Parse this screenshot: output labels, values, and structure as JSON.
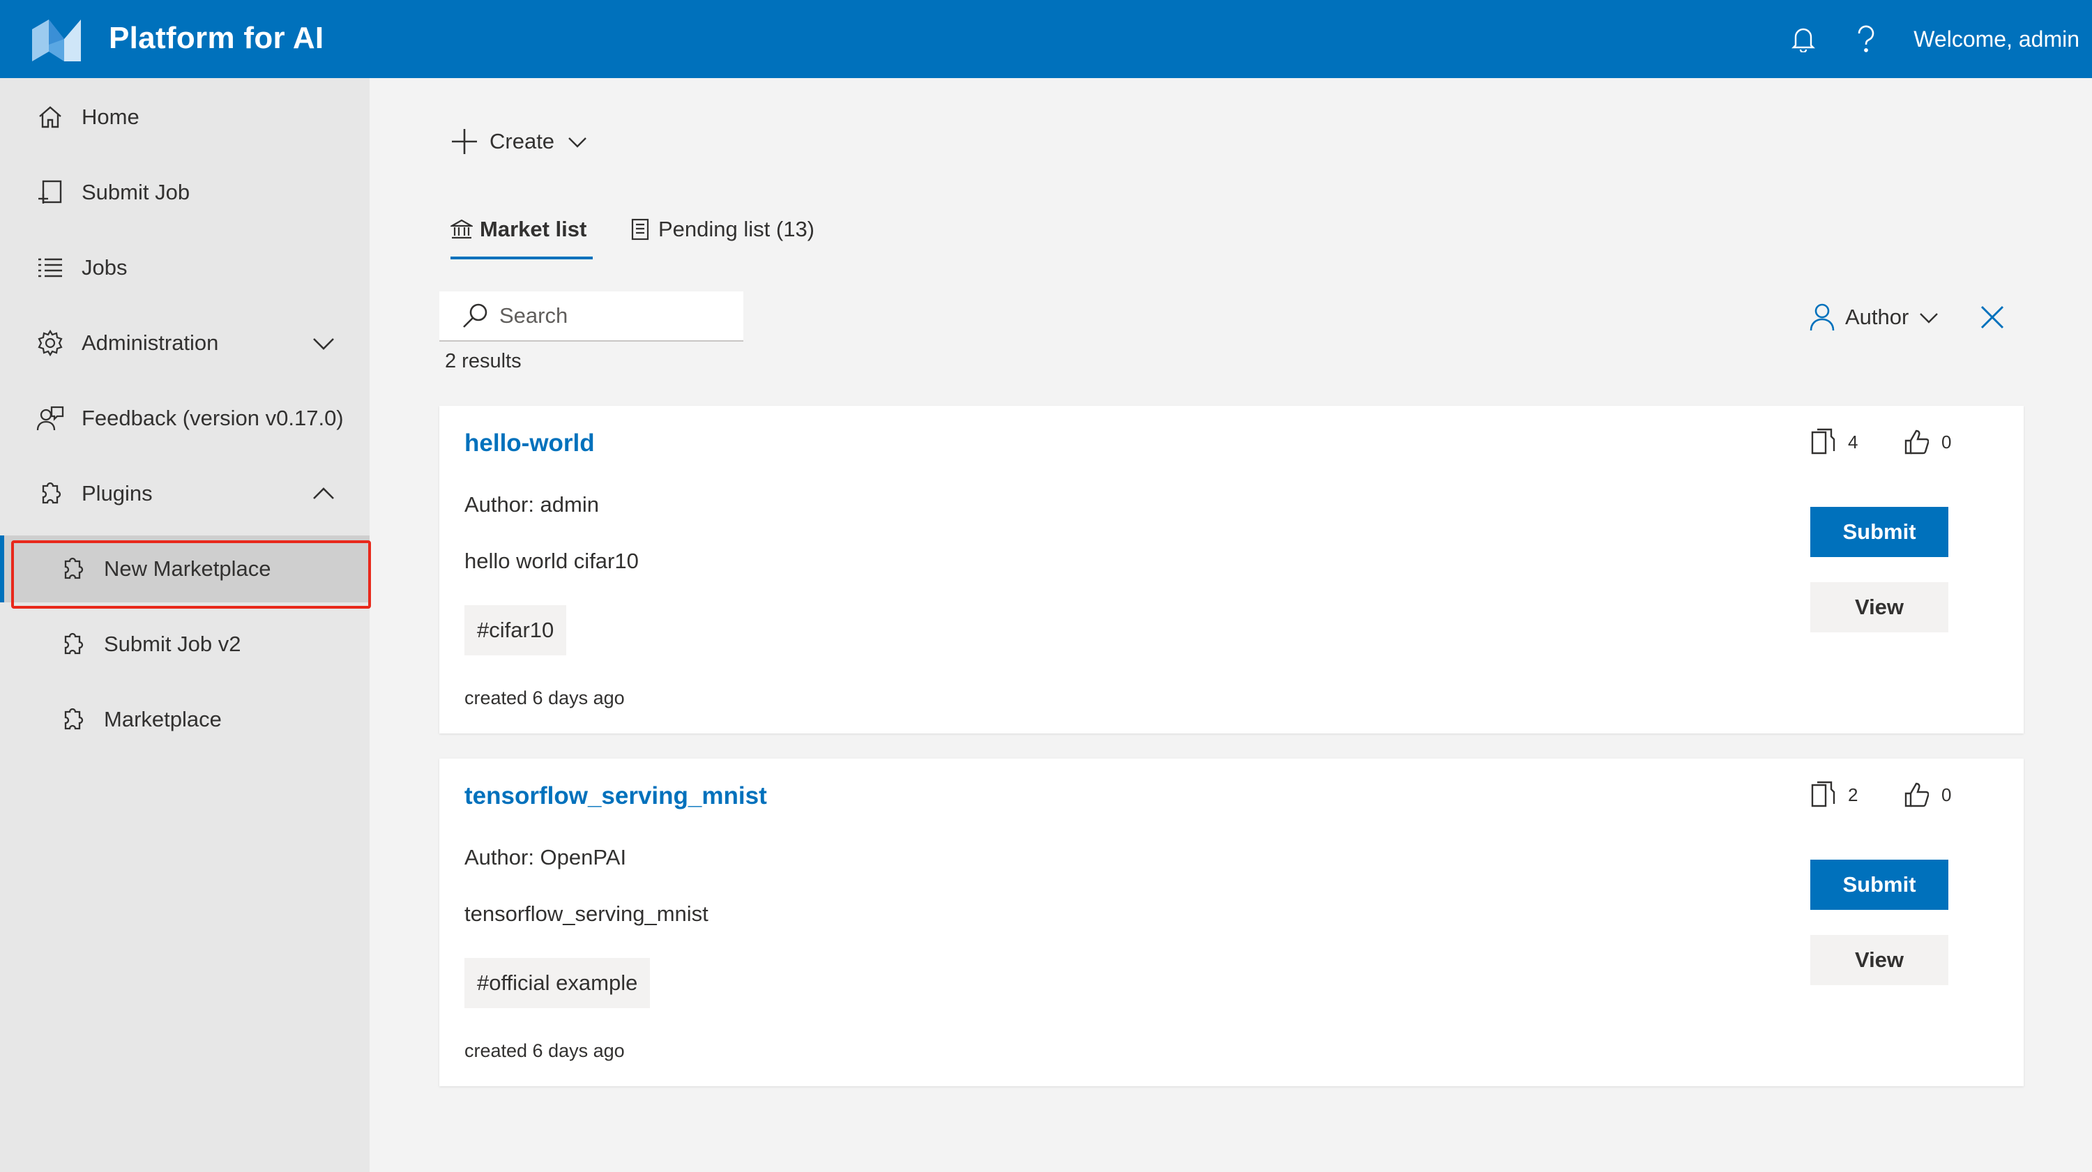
{
  "header": {
    "app_title": "Platform for AI",
    "welcome": "Welcome, admin",
    "icons": [
      "app-logo",
      "bell-icon",
      "help-icon"
    ],
    "brand_color": "#0071bc"
  },
  "sidebar": {
    "items": [
      {
        "label": "Home",
        "icon": "home-icon"
      },
      {
        "label": "Submit Job",
        "icon": "submit-job-icon"
      },
      {
        "label": "Jobs",
        "icon": "list-icon"
      },
      {
        "label": "Administration",
        "icon": "gear-icon",
        "expandable": true,
        "expanded": false
      },
      {
        "label": "Feedback (version v0.17.0)",
        "icon": "feedback-icon"
      },
      {
        "label": "Plugins",
        "icon": "puzzle-icon",
        "expandable": true,
        "expanded": true
      }
    ],
    "plugin_items": [
      {
        "label": "New Marketplace",
        "icon": "puzzle-icon",
        "selected": true
      },
      {
        "label": "Submit Job v2",
        "icon": "puzzle-icon"
      },
      {
        "label": "Marketplace",
        "icon": "puzzle-icon"
      }
    ],
    "highlight_color": "#e8291c"
  },
  "main": {
    "create_label": "Create",
    "tabs": [
      {
        "label": "Market list",
        "icon": "bank-icon",
        "active": true
      },
      {
        "label": "Pending list (13)",
        "icon": "clipboard-icon",
        "active": false
      }
    ],
    "search": {
      "placeholder": "Search",
      "value": ""
    },
    "results_count": "2 results",
    "author_filter_label": "Author",
    "cards": [
      {
        "title": "hello-world",
        "author": "Author: admin",
        "description": "hello world cifar10",
        "tag": "#cifar10",
        "created": "created 6 days ago",
        "submits": "4",
        "likes": "0",
        "submit_label": "Submit",
        "view_label": "View"
      },
      {
        "title": "tensorflow_serving_mnist",
        "author": "Author: OpenPAI",
        "description": "tensorflow_serving_mnist",
        "tag": "#official example",
        "created": "created 6 days ago",
        "submits": "2",
        "likes": "0",
        "submit_label": "Submit",
        "view_label": "View"
      }
    ]
  }
}
